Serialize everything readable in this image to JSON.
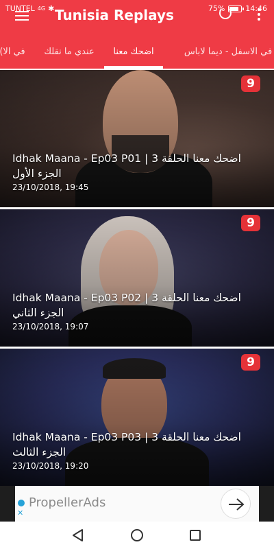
{
  "status_bar": {
    "carrier": "TUNTEL",
    "network": "4G",
    "battery": "75%",
    "time": "14:46"
  },
  "app_bar": {
    "title": "Tunisia Replays"
  },
  "tabs": [
    {
      "label": "(في الا"
    },
    {
      "label": "عندي ما نقلك"
    },
    {
      "label": "اضحك معنا",
      "active": true
    },
    {
      "label": "في الاسفل - ديما لاباس"
    }
  ],
  "videos": [
    {
      "title_line1": "Idhak Maana - Ep03 P01 | اضحك معنا الحلقة 3",
      "title_line2": "الجزء الأول",
      "date": "23/10/2018, 19:45",
      "channel_logo": "9"
    },
    {
      "title_line1": "Idhak Maana - Ep03 P02 | اضحك معنا الحلقة 3",
      "title_line2": "الجزء الثاني",
      "date": "23/10/2018, 19:07",
      "channel_logo": "9"
    },
    {
      "title_line1": "Idhak Maana - Ep03 P03 | اضحك معنا الحلقة 3",
      "title_line2": "الجزء الثالث",
      "date": "23/10/2018, 19:20",
      "channel_logo": "9"
    }
  ],
  "ad": {
    "text": "PropellerAds",
    "close": "✕"
  },
  "colors": {
    "accent": "#ef3b45",
    "ad_blue": "#27a3d8"
  }
}
